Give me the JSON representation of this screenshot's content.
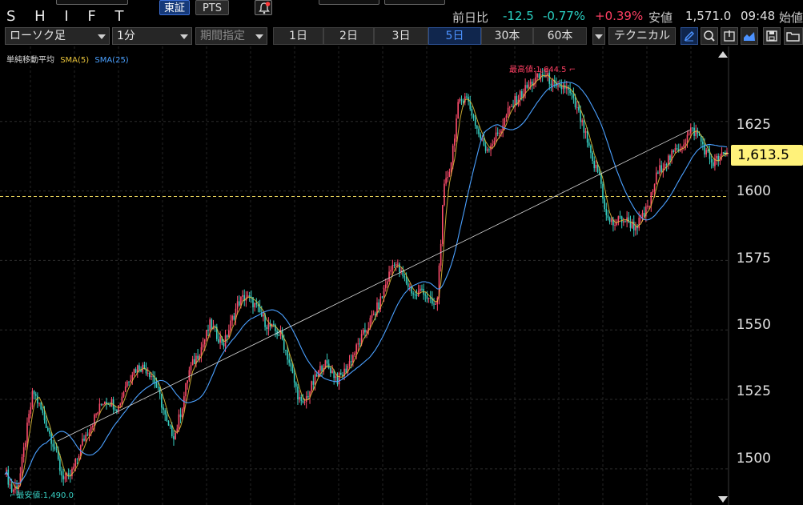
{
  "header": {
    "ticker": "S H I F T",
    "exchange_tse": "東証",
    "exchange_pts": "PTS",
    "bell_icon": "bell-alert-icon",
    "quote": {
      "change_label": "前日比",
      "change_value": "-12.5",
      "change_pct": "-0.77%",
      "other_pct": "+0.39%",
      "low_label": "安値",
      "low_value": "1,571.0",
      "time": "09:48",
      "open_label": "始値"
    }
  },
  "toolbar": {
    "chart_type": "ローソク足",
    "interval": "1分",
    "period": "期間指定",
    "ranges": [
      "1日",
      "2日",
      "3日",
      "5日",
      "30本",
      "60本"
    ],
    "active_range": "5日",
    "technical": "テクニカル",
    "icons": [
      "pen-icon",
      "zoom-icon",
      "exit-icon",
      "area-chart-icon",
      "save-icon",
      "folder-icon"
    ]
  },
  "legend": {
    "title": "単純移動平均",
    "sma5": "SMA(5)",
    "sma25": "SMA(25)"
  },
  "annotations": {
    "high": "最高値:1,644.5",
    "low": "最安値:1,490.0",
    "current_price": "1,613.5"
  },
  "colors": {
    "up": "#ff4d6d",
    "down": "#37d0c3",
    "sma5": "#e8c33a",
    "sma25": "#4aa0ff",
    "price_tag": "#fff27a"
  },
  "chart_data": {
    "type": "line",
    "y_axis_ticks": [
      1625,
      1600,
      1575,
      1550,
      1525,
      1500
    ],
    "ylim": [
      1487,
      1652
    ],
    "reference_line": 1598,
    "current_price": 1613.5,
    "high": 1644.5,
    "low": 1490.0,
    "trendline": [
      1510,
      1622
    ],
    "price_path": [
      1500,
      1492,
      1495,
      1512,
      1528,
      1522,
      1515,
      1508,
      1498,
      1496,
      1502,
      1510,
      1515,
      1520,
      1525,
      1524,
      1522,
      1530,
      1535,
      1537,
      1536,
      1533,
      1525,
      1515,
      1512,
      1522,
      1535,
      1540,
      1545,
      1552,
      1548,
      1545,
      1553,
      1560,
      1562,
      1560,
      1556,
      1552,
      1550,
      1548,
      1540,
      1530,
      1522,
      1528,
      1533,
      1538,
      1536,
      1532,
      1535,
      1540,
      1545,
      1550,
      1555,
      1560,
      1568,
      1575,
      1570,
      1566,
      1562,
      1565,
      1560,
      1558,
      1600,
      1610,
      1630,
      1635,
      1628,
      1620,
      1615,
      1618,
      1622,
      1628,
      1632,
      1635,
      1638,
      1640,
      1642,
      1640,
      1636,
      1638,
      1634,
      1628,
      1620,
      1610,
      1606,
      1590,
      1588,
      1590,
      1589,
      1587,
      1590,
      1595,
      1605,
      1610,
      1612,
      1615,
      1618,
      1622,
      1620,
      1614,
      1610,
      1612,
      1613.5
    ]
  }
}
